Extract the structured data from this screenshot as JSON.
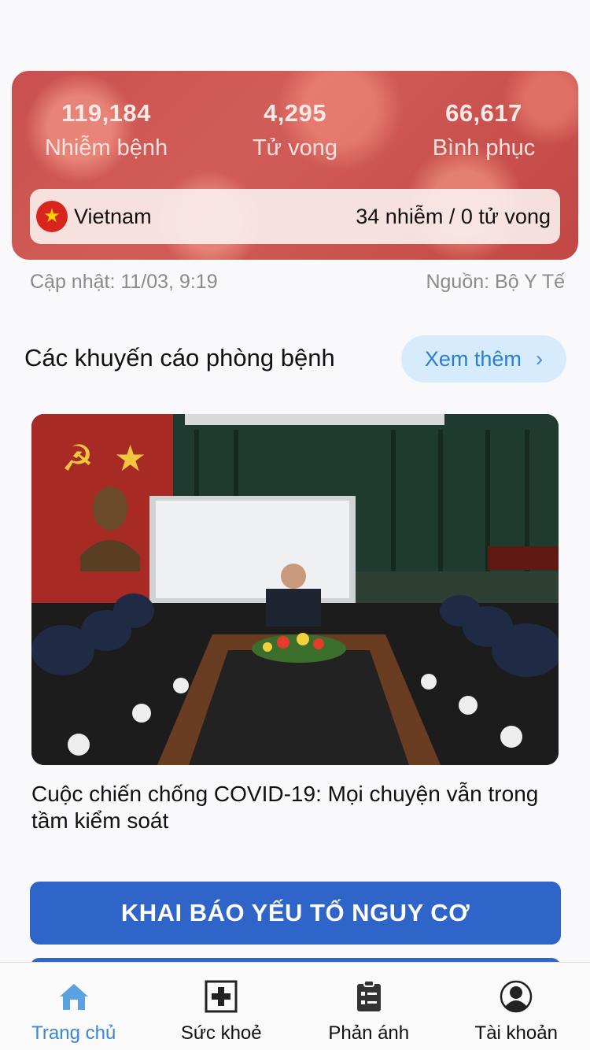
{
  "stats": {
    "infected": {
      "value": "119,184",
      "label": "Nhiễm bệnh"
    },
    "deaths": {
      "value": "4,295",
      "label": "Tử vong"
    },
    "recovered": {
      "value": "66,617",
      "label": "Bình phục"
    }
  },
  "country": {
    "name": "Vietnam",
    "summary": "34 nhiễm / 0 tử vong"
  },
  "meta": {
    "updated": "Cập nhật: 11/03, 9:19",
    "source": "Nguồn: Bộ Y Tế"
  },
  "section": {
    "title": "Các khuyến cáo phòng bệnh",
    "more_label": "Xem thêm"
  },
  "news": {
    "title": "Cuộc chiến chống COVID-19: Mọi chuyện vẫn trong tầm kiểm soát"
  },
  "cta": {
    "label": "KHAI BÁO YẾU TỐ NGUY CƠ"
  },
  "tabs": [
    {
      "label": "Trang chủ",
      "icon": "home-icon",
      "active": true
    },
    {
      "label": "Sức khoẻ",
      "icon": "medical-cross-icon",
      "active": false
    },
    {
      "label": "Phản ánh",
      "icon": "clipboard-icon",
      "active": false
    },
    {
      "label": "Tài khoản",
      "icon": "user-avatar-icon",
      "active": false
    }
  ],
  "colors": {
    "primary": "#2f64c9",
    "accent": "#3a86d8",
    "card": "#c9504e",
    "pill": "#d6ebfb"
  }
}
